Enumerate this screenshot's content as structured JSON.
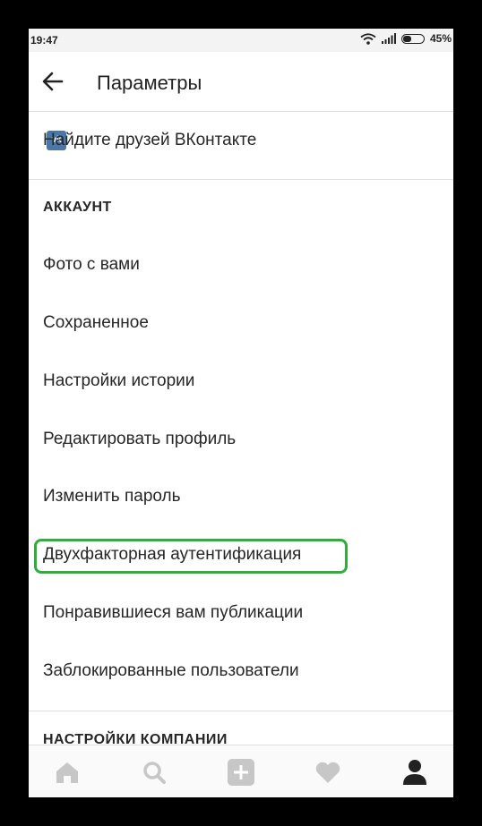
{
  "status_bar": {
    "time": "19:47",
    "battery": "45%",
    "battery_level": 0.45
  },
  "header": {
    "title": "Параметры",
    "back_icon": "arrow-left-icon"
  },
  "vk_item": {
    "label": "Найдите друзей ВКонтакте",
    "icon": "vk-icon"
  },
  "account_section": {
    "heading": "АККАУНТ",
    "items": [
      "Фото с вами",
      "Сохраненное",
      "Настройки истории",
      "Редактировать профиль",
      "Изменить пароль",
      "Двухфакторная аутентификация",
      "Понравившиеся вам публикации",
      "Заблокированные пользователи"
    ]
  },
  "company_section": {
    "heading": "НАСТРОЙКИ КОМПАНИИ"
  },
  "bottom_nav": [
    "home-icon",
    "search-icon",
    "add-icon",
    "heart-icon",
    "profile-icon"
  ],
  "colors": {
    "highlight": "#2fae3b",
    "vk": "#4a76a8"
  }
}
